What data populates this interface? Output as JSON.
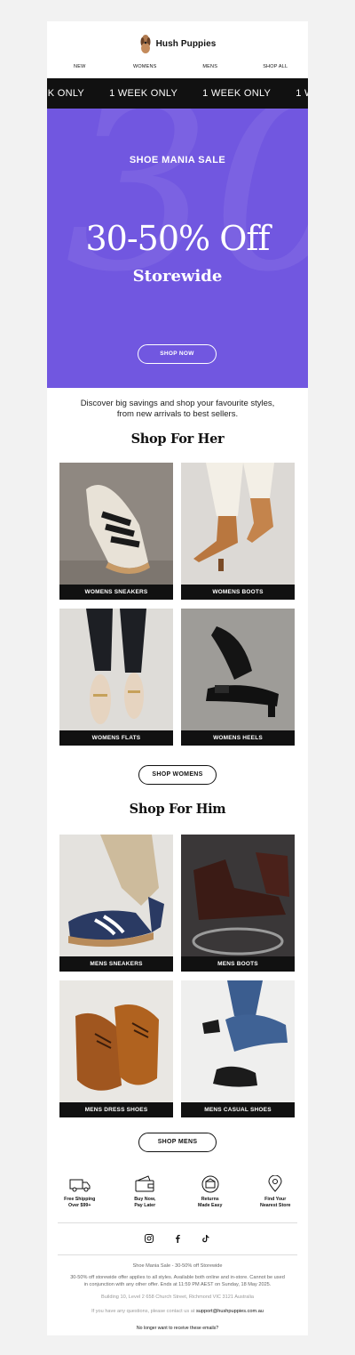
{
  "brand": {
    "name": "Hush Puppies"
  },
  "nav": [
    "NEW",
    "WOMENS",
    "MENS",
    "SHOP ALL"
  ],
  "ticker": {
    "text": "1 WEEK ONLY"
  },
  "hero": {
    "eyebrow": "SHOE MANIA SALE",
    "title": "30-50% Off",
    "subtitle": "Storewide",
    "button": "SHOP NOW",
    "bg_color": "#7157e0"
  },
  "intro": {
    "line1": "Discover big savings and shop your favourite styles,",
    "line2": "from new arrivals to best sellers."
  },
  "her": {
    "title": "Shop For Her",
    "tiles": [
      "WOMENS SNEAKERS",
      "WOMENS BOOTS",
      "WOMENS FLATS",
      "WOMENS HEELS"
    ],
    "button": "SHOP WOMENS"
  },
  "him": {
    "title": "Shop For Him",
    "tiles": [
      "MENS SNEAKERS",
      "MENS BOOTS",
      "MENS DRESS SHOES",
      "MENS CASUAL SHOES"
    ],
    "button": "SHOP MENS"
  },
  "features": [
    {
      "icon": "truck-icon",
      "line1": "Free Shipping",
      "line2": "Over $99+"
    },
    {
      "icon": "wallet-icon",
      "line1": "Buy Now,",
      "line2": "Pay Later"
    },
    {
      "icon": "return-box-icon",
      "line1": "Returns",
      "line2": "Made Easy"
    },
    {
      "icon": "location-pin-icon",
      "line1": "Find Your",
      "line2": "Nearest Store"
    }
  ],
  "social": [
    "instagram-icon",
    "facebook-icon",
    "tiktok-icon"
  ],
  "footer": {
    "headline": "Shoe Mania Sale - 30-50% off Storewide",
    "terms1": "30-50% off storewide offer applies to all styles. Available both online and in-store. Cannot be used",
    "terms2": "in conjunction with any other offer. Ends at 11:59 PM AEST on Sunday, 18 May 2025.",
    "address": "Building 10, Level 2 658 Church Street, Richmond VIC 3121 Australia",
    "contact_prefix": "If you have any questions, please contact us at",
    "email": "support@hushpuppies.com.au",
    "unsubscribe": "No longer want to receive these emails?"
  }
}
